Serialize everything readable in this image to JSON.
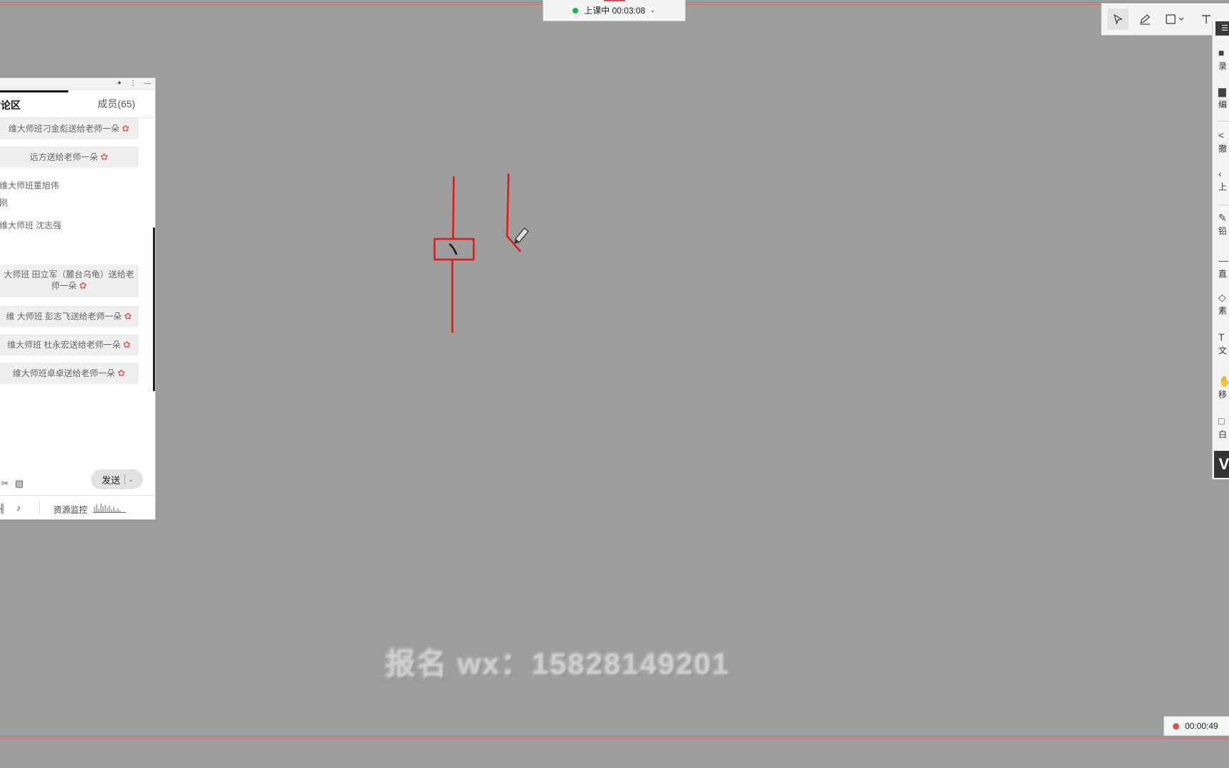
{
  "class_status": {
    "text": "上课中 00:03:08",
    "status_color": "#21b34b",
    "chevron_icon": "chevron-down-icon"
  },
  "toolbar": {
    "tools": [
      "select-arrow-icon",
      "pen-icon",
      "rectangle-shape-icon",
      "text-tool-icon"
    ]
  },
  "side_panel": {
    "items": [
      {
        "icon": "record-icon",
        "label": "录"
      },
      {
        "icon": "edit-icon",
        "label": "编"
      },
      {
        "icon": "undo-icon",
        "label": "撤"
      },
      {
        "icon": "previous-icon",
        "label": "上"
      },
      {
        "icon": "pencil-icon",
        "label": "铅"
      },
      {
        "icon": "line-icon",
        "label": "直"
      },
      {
        "icon": "eraser-icon",
        "label": "素"
      },
      {
        "icon": "text-icon",
        "label": "文"
      },
      {
        "icon": "hand-move-icon",
        "label": "移"
      },
      {
        "icon": "whiteboard-icon",
        "label": "白"
      }
    ],
    "logo": "V"
  },
  "chat": {
    "tabs": [
      {
        "label": "讨论区",
        "active": true
      },
      {
        "label": "成员(65)",
        "active": false
      }
    ],
    "messages": [
      {
        "type": "system",
        "text": "维大师班刁金彪送给老师一朵"
      },
      {
        "type": "system",
        "text": "远方送给老师一朵"
      },
      {
        "type": "text",
        "text": "维大师班董旭伟"
      },
      {
        "type": "text",
        "text": "刚"
      },
      {
        "type": "text",
        "text": "维大师班 沈志强"
      },
      {
        "type": "system",
        "text": "大师班 田立军（麓台乌龟）送给老师一朵"
      },
      {
        "type": "system",
        "text": "维 大师班 彭志飞送给老师一朵"
      },
      {
        "type": "system",
        "text": "维大师班 杜永宏送给老师一朵"
      },
      {
        "type": "system",
        "text": "维大师班卓卓送给老师一朵"
      }
    ],
    "send_label": "发送",
    "resource_monitor_label": "资源监控"
  },
  "watermark_text": "报名 wx：15828149201",
  "recording": {
    "time": "00:00:49",
    "color": "#e24d4d"
  },
  "drawing": {
    "stroke_color": "#e11b1b"
  }
}
